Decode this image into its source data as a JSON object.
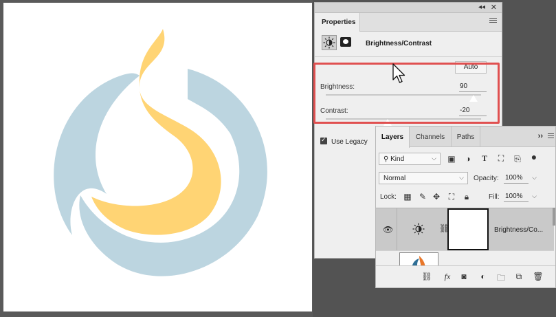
{
  "properties": {
    "title": "Properties",
    "adjustment_name": "Brightness/Contrast",
    "auto_label": "Auto",
    "brightness_label": "Brightness:",
    "brightness_value": "90",
    "contrast_label": "Contrast:",
    "contrast_value": "-20",
    "use_legacy_label": "Use Legacy",
    "use_legacy_checked": true
  },
  "layers": {
    "tabs": [
      "Layers",
      "Channels",
      "Paths"
    ],
    "filter_kind": "Kind",
    "blend_mode": "Normal",
    "opacity_label": "Opacity:",
    "opacity_value": "100%",
    "lock_label": "Lock:",
    "fill_label": "Fill:",
    "fill_value": "100%",
    "layer_name": "Brightness/Co..."
  },
  "colors": {
    "logo_blue": "#bcd5e0",
    "logo_yellow": "#ffd474",
    "highlight_red": "#e05050"
  }
}
